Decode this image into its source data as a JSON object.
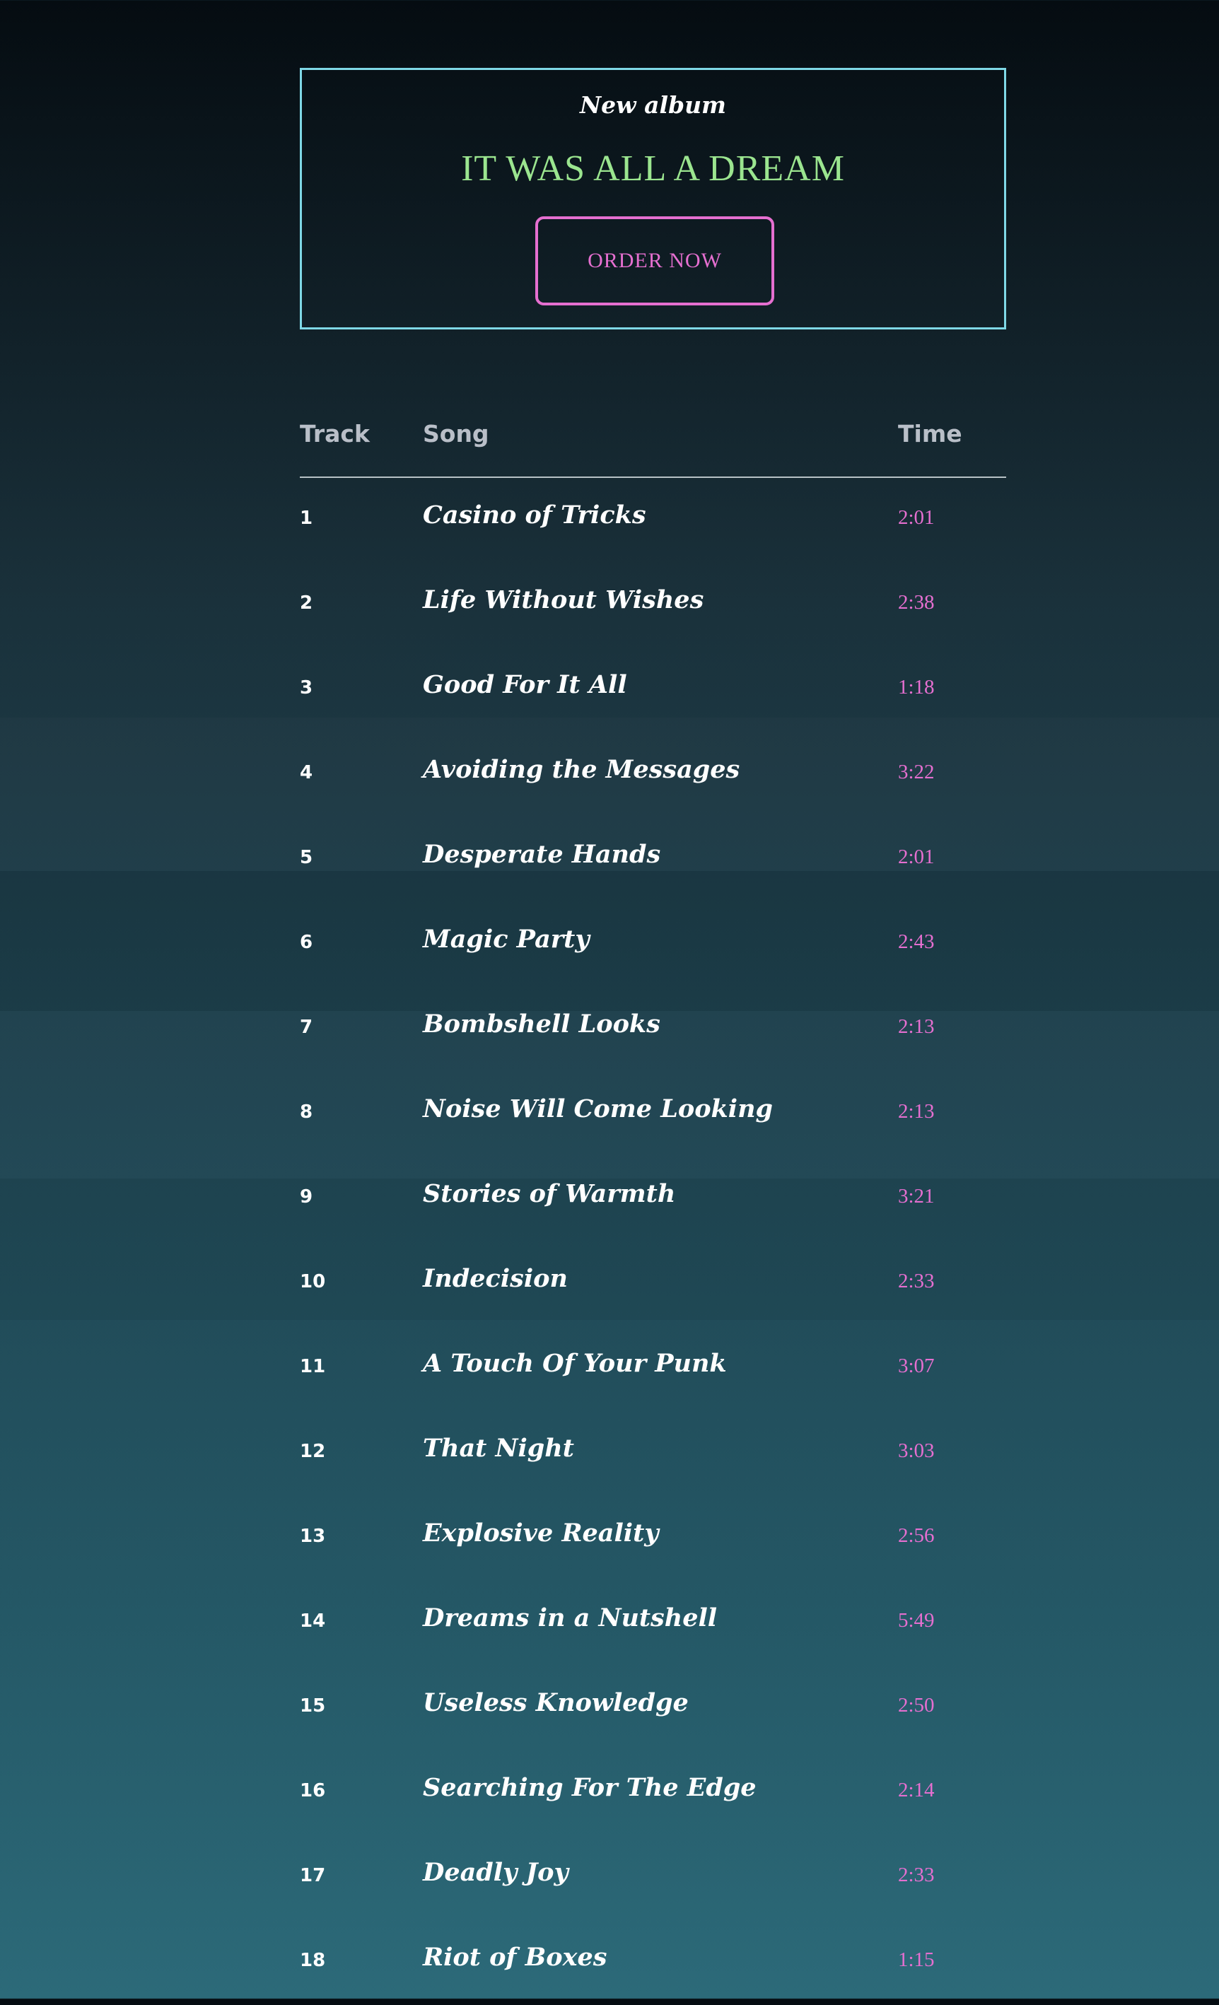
{
  "promo": {
    "kicker": "New album",
    "title": "IT WAS ALL A DREAM",
    "button_label": "ORDER NOW"
  },
  "tracklist": {
    "headers": {
      "track": "Track",
      "song": "Song",
      "time": "Time"
    },
    "tracks": [
      {
        "num": "1",
        "song": "Casino of Tricks",
        "time": "2:01"
      },
      {
        "num": "2",
        "song": "Life Without Wishes",
        "time": "2:38"
      },
      {
        "num": "3",
        "song": "Good For It All",
        "time": "1:18"
      },
      {
        "num": "4",
        "song": "Avoiding the Messages",
        "time": "3:22"
      },
      {
        "num": "5",
        "song": "Desperate Hands",
        "time": "2:01"
      },
      {
        "num": "6",
        "song": "Magic Party",
        "time": "2:43"
      },
      {
        "num": "7",
        "song": "Bombshell Looks",
        "time": "2:13"
      },
      {
        "num": "8",
        "song": "Noise Will Come Looking",
        "time": "2:13"
      },
      {
        "num": "9",
        "song": "Stories of Warmth",
        "time": "3:21"
      },
      {
        "num": "10",
        "song": "Indecision",
        "time": "2:33"
      },
      {
        "num": "11",
        "song": "A Touch Of Your Punk",
        "time": "3:07"
      },
      {
        "num": "12",
        "song": "That Night",
        "time": "3:03"
      },
      {
        "num": "13",
        "song": "Explosive Reality",
        "time": "2:56"
      },
      {
        "num": "14",
        "song": "Dreams in a Nutshell",
        "time": "5:49"
      },
      {
        "num": "15",
        "song": "Useless Knowledge",
        "time": "2:50"
      },
      {
        "num": "16",
        "song": "Searching For The Edge",
        "time": "2:14"
      },
      {
        "num": "17",
        "song": "Deadly Joy",
        "time": "2:33"
      },
      {
        "num": "18",
        "song": "Riot of Boxes",
        "time": "1:15"
      }
    ]
  },
  "colors": {
    "border_accent": "#7fd8e6",
    "title_accent": "#9be58f",
    "pink_accent": "#e56fd0",
    "header_text": "#b9bfc8"
  }
}
